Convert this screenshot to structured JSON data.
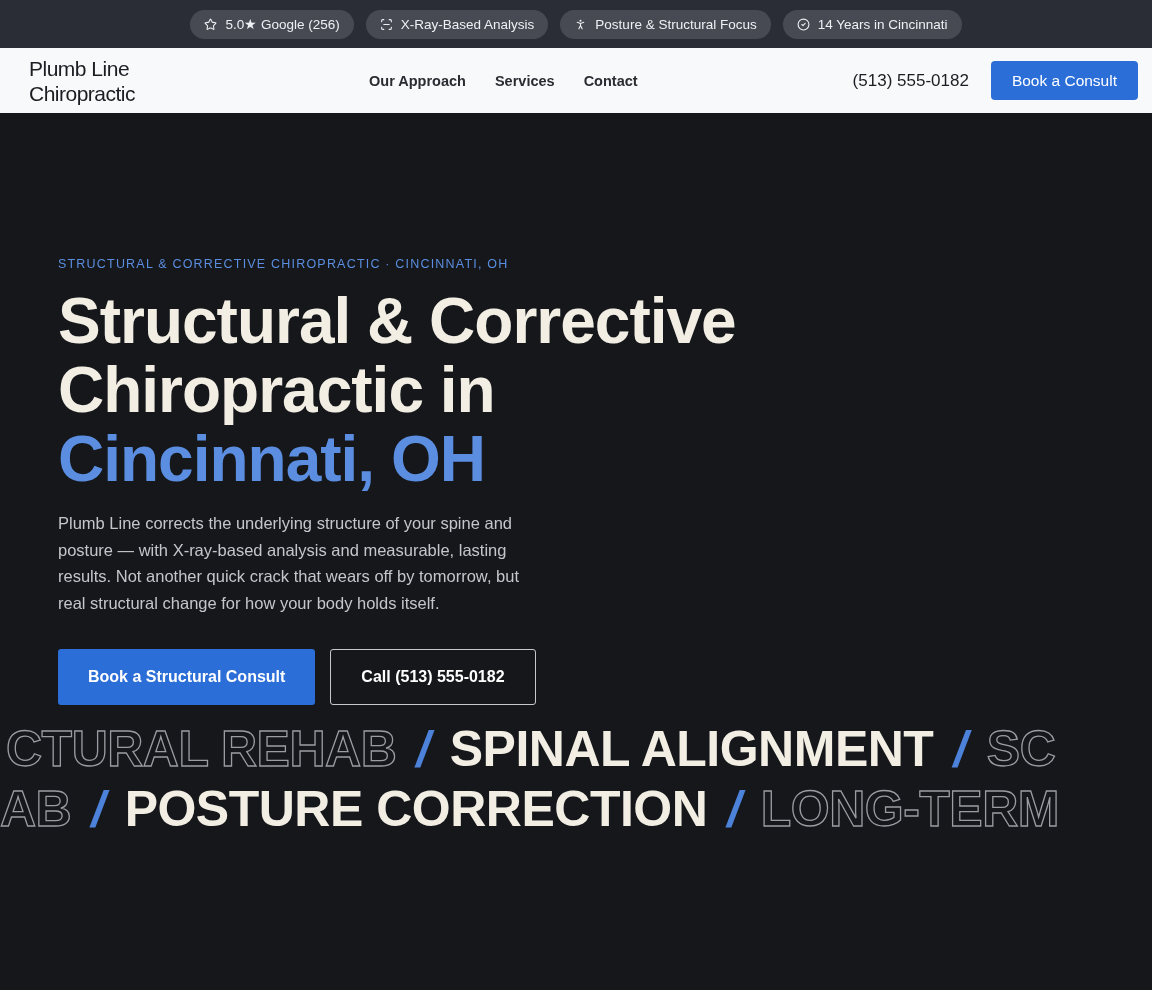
{
  "top_badges": [
    {
      "kind": "star",
      "label": "5.0★ Google (256)"
    },
    {
      "kind": "scan",
      "label": "X-Ray-Based Analysis"
    },
    {
      "kind": "person",
      "label": "Posture & Structural Focus"
    },
    {
      "kind": "check",
      "label": "14 Years in Cincinnati"
    }
  ],
  "header": {
    "logo_line_1": "Plumb Line",
    "logo_line_2": "Chiropractic",
    "nav": [
      "Our Approach",
      "Services",
      "Contact"
    ],
    "phone": "(513) 555-0182",
    "cta": "Book a Consult"
  },
  "hero": {
    "eyebrow": "STRUCTURAL & CORRECTIVE CHIROPRACTIC · CINCINNATI, OH",
    "title_line_1": "Structural & Corrective",
    "title_line_2": "Chiropractic in",
    "title_accent": "Cincinnati, OH",
    "body": "Plumb Line corrects the underlying structure of your spine and posture — with X-ray-based analysis and measurable, lasting results. Not another quick crack that wears off by tomorrow, but real structural change for how your body holds itself.",
    "primary_button": "Book a Structural Consult",
    "secondary_button": "Call (513) 555-0182"
  },
  "marquee": [
    [
      {
        "kind": "outline",
        "text": "CTURAL REHAB"
      },
      {
        "kind": "slash",
        "text": "/"
      },
      {
        "kind": "solid",
        "text": "SPINAL ALIGNMENT"
      },
      {
        "kind": "slash",
        "text": "/"
      },
      {
        "kind": "outline",
        "text": "SC"
      }
    ],
    [
      {
        "kind": "outline",
        "text": "AB"
      },
      {
        "kind": "slash",
        "text": "/"
      },
      {
        "kind": "solid",
        "text": "POSTURE CORRECTION"
      },
      {
        "kind": "slash",
        "text": "/"
      },
      {
        "kind": "outline",
        "text": "LONG-TERM"
      }
    ]
  ]
}
